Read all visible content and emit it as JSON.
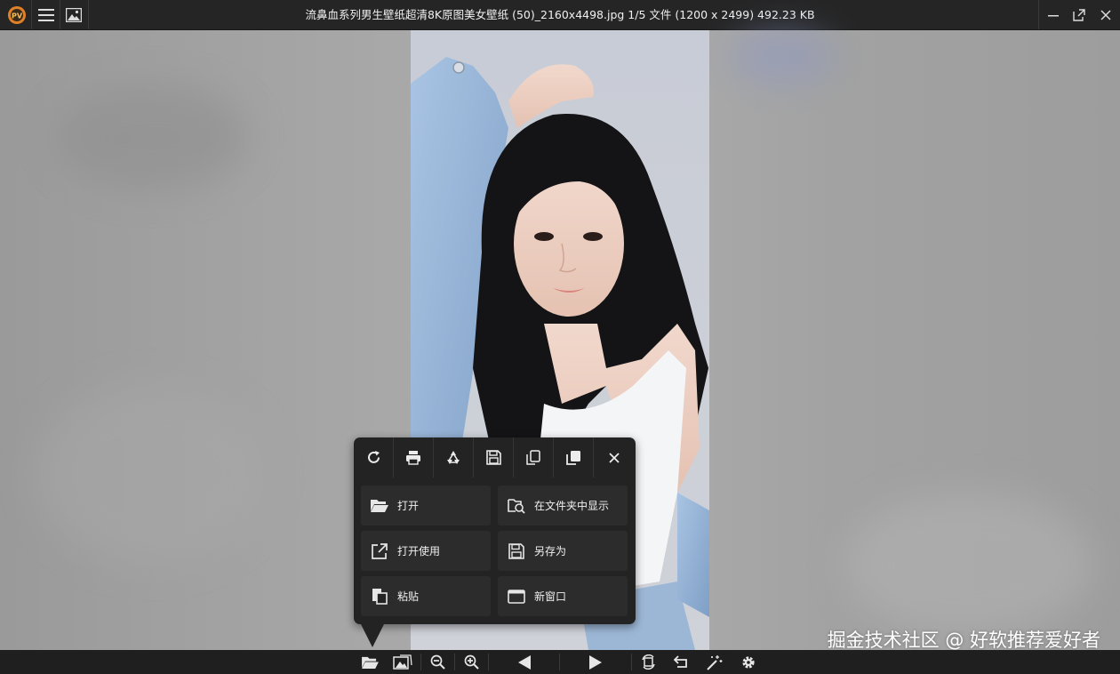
{
  "window": {
    "title": "流鼻血系列男生壁纸超清8K原图美女壁纸 (50)_2160x4498.jpg 1/5 文件 (1200 x 2499) 492.23 KB"
  },
  "titlebar_icons": {
    "app": "app-logo-icon",
    "menu": "hamburger-menu-icon",
    "gallery": "image-gallery-icon",
    "minimize": "minimize-icon",
    "maximize": "maximize-icon",
    "close": "close-icon"
  },
  "popup": {
    "toolbar_icons": [
      "reload-icon",
      "print-icon",
      "recycle-icon",
      "save-icon",
      "copy-icon",
      "copy-path-icon",
      "close-icon"
    ],
    "menu": [
      {
        "label": "打开",
        "icon": "folder-open-icon"
      },
      {
        "label": "在文件夹中显示",
        "icon": "folder-search-icon"
      },
      {
        "label": "打开使用",
        "icon": "open-external-icon"
      },
      {
        "label": "另存为",
        "icon": "save-as-icon"
      },
      {
        "label": "粘贴",
        "icon": "paste-icon"
      },
      {
        "label": "新窗口",
        "icon": "new-window-icon"
      }
    ]
  },
  "bottombar_icons": [
    "folder-open-icon",
    "image-gallery-icon",
    "zoom-out-icon",
    "zoom-in-icon",
    "previous-icon",
    "next-icon",
    "rotate-icon",
    "undo-icon",
    "magic-wand-icon",
    "settings-gear-icon"
  ],
  "watermark": "掘金技术社区 @ 好软推荐爱好者",
  "colors": {
    "titlebar": "#252525",
    "popup": "#232323",
    "popup_item": "#2c2c2c",
    "bottombar": "#1f1f1f"
  }
}
